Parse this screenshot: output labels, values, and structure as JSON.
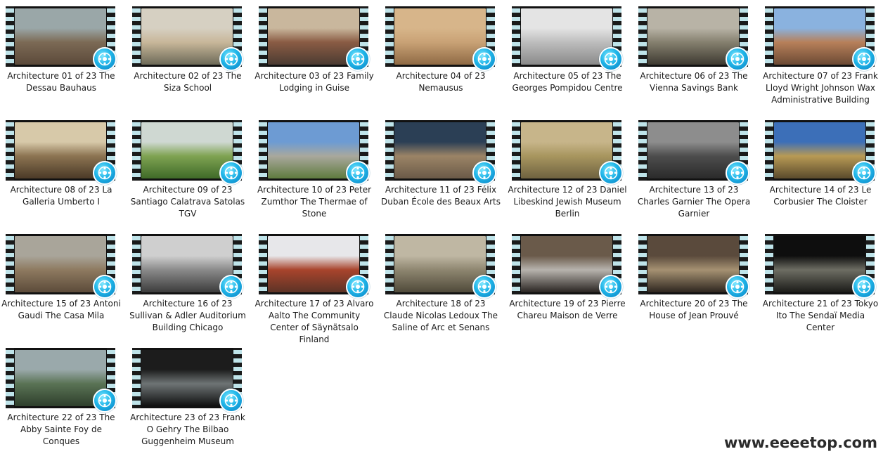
{
  "items": [
    {
      "label": "Architecture 01 of 23 The Dessau Bauhaus",
      "thumb": [
        "#9aa7a8",
        "#7c6a55",
        "#5b4a3a"
      ]
    },
    {
      "label": "Architecture 02 of 23 The Siza School",
      "thumb": [
        "#d6d0c2",
        "#c8b79a",
        "#6d6a58"
      ]
    },
    {
      "label": "Architecture 03 of 23 Family Lodging in Guise",
      "thumb": [
        "#c9b79d",
        "#8a5c44",
        "#4b3b32"
      ]
    },
    {
      "label": "Architecture 04 of 23 Nemausus",
      "thumb": [
        "#d7b58a",
        "#c9a276",
        "#8f6a44"
      ]
    },
    {
      "label": "Architecture 05 of 23 The Georges Pompidou Centre",
      "thumb": [
        "#e4e4e4",
        "#bdbdbd",
        "#8a8a8a"
      ]
    },
    {
      "label": "Architecture 06 of 23 The Vienna Savings Bank",
      "thumb": [
        "#b8b3a6",
        "#85806f",
        "#3e3a31"
      ]
    },
    {
      "label": "Architecture 07 of 23 Frank Lloyd Wright Johnson Wax Administrative Building",
      "thumb": [
        "#8ab2df",
        "#b7805a",
        "#6c4a34"
      ]
    },
    {
      "label": "Architecture 08 of 23 La Galleria Umberto I",
      "thumb": [
        "#d7c9a9",
        "#8c7452",
        "#4b3a27"
      ]
    },
    {
      "label": "Architecture 09 of 23 Santiago Calatrava Satolas TGV",
      "thumb": [
        "#cfd8d2",
        "#7fa352",
        "#3f6a28"
      ]
    },
    {
      "label": "Architecture 10 of 23 Peter Zumthor The Thermae of Stone",
      "thumb": [
        "#6d9bd3",
        "#a9a89d",
        "#5f7b3e"
      ]
    },
    {
      "label": "Architecture 11 of 23 Félix Duban École des Beaux Arts",
      "thumb": [
        "#2b3f55",
        "#9b8466",
        "#6b5a48"
      ]
    },
    {
      "label": "Architecture 12 of 23 Daniel Libeskind Jewish Museum Berlin",
      "thumb": [
        "#c7b58a",
        "#a8965f",
        "#6f6240"
      ]
    },
    {
      "label": "Architecture 13 of 23 Charles Garnier The Opera Garnier",
      "thumb": [
        "#8d8d8d",
        "#4d4d4d",
        "#2a2a2a"
      ]
    },
    {
      "label": "Architecture 14 of 23 Le Corbusier The Cloister",
      "thumb": [
        "#3c6fb8",
        "#b89a55",
        "#5a4a2c"
      ]
    },
    {
      "label": "Architecture 15 of 23 Antoni Gaudi The Casa Mila",
      "thumb": [
        "#a9a59a",
        "#8e7a60",
        "#5c4b3a"
      ]
    },
    {
      "label": "Architecture 16 of 23 Sullivan & Adler Auditorium Building Chicago",
      "thumb": [
        "#cfcfcf",
        "#8a8a8a",
        "#3c3c3c"
      ]
    },
    {
      "label": "Architecture 17 of 23 Alvaro Aalto The Community Center of Säynätsalo Finland",
      "thumb": [
        "#e7e7ea",
        "#a8442c",
        "#5c3326"
      ]
    },
    {
      "label": "Architecture 18 of 23 Claude Nicolas Ledoux The Saline of Arc et Senans",
      "thumb": [
        "#bfb7a3",
        "#8e8670",
        "#4f4a3a"
      ]
    },
    {
      "label": "Architecture 19 of 23 Pierre Chareu Maison de Verre",
      "thumb": [
        "#6a5a4a",
        "#b7b3ad",
        "#2a2522"
      ]
    },
    {
      "label": "Architecture 20 of 23 The House of Jean Prouvé",
      "thumb": [
        "#5a4a3c",
        "#a59172",
        "#2e261f"
      ]
    },
    {
      "label": "Architecture 21 of 23 Tokyo Ito The Sendaï Media Center",
      "thumb": [
        "#0e0e0e",
        "#6d6d63",
        "#1b1b18"
      ]
    },
    {
      "label": "Architecture 22 of 23 The Abby Sainte Foy de Conques",
      "thumb": [
        "#9aa9ab",
        "#5a7355",
        "#2e3f2c"
      ]
    },
    {
      "label": "Architecture 23 of 23 Frank O Gehry The Bilbao Guggenheim Museum",
      "thumb": [
        "#1c1c1c",
        "#6e7475",
        "#0f0f0f"
      ]
    }
  ],
  "watermark": "www.eeeetop.com"
}
